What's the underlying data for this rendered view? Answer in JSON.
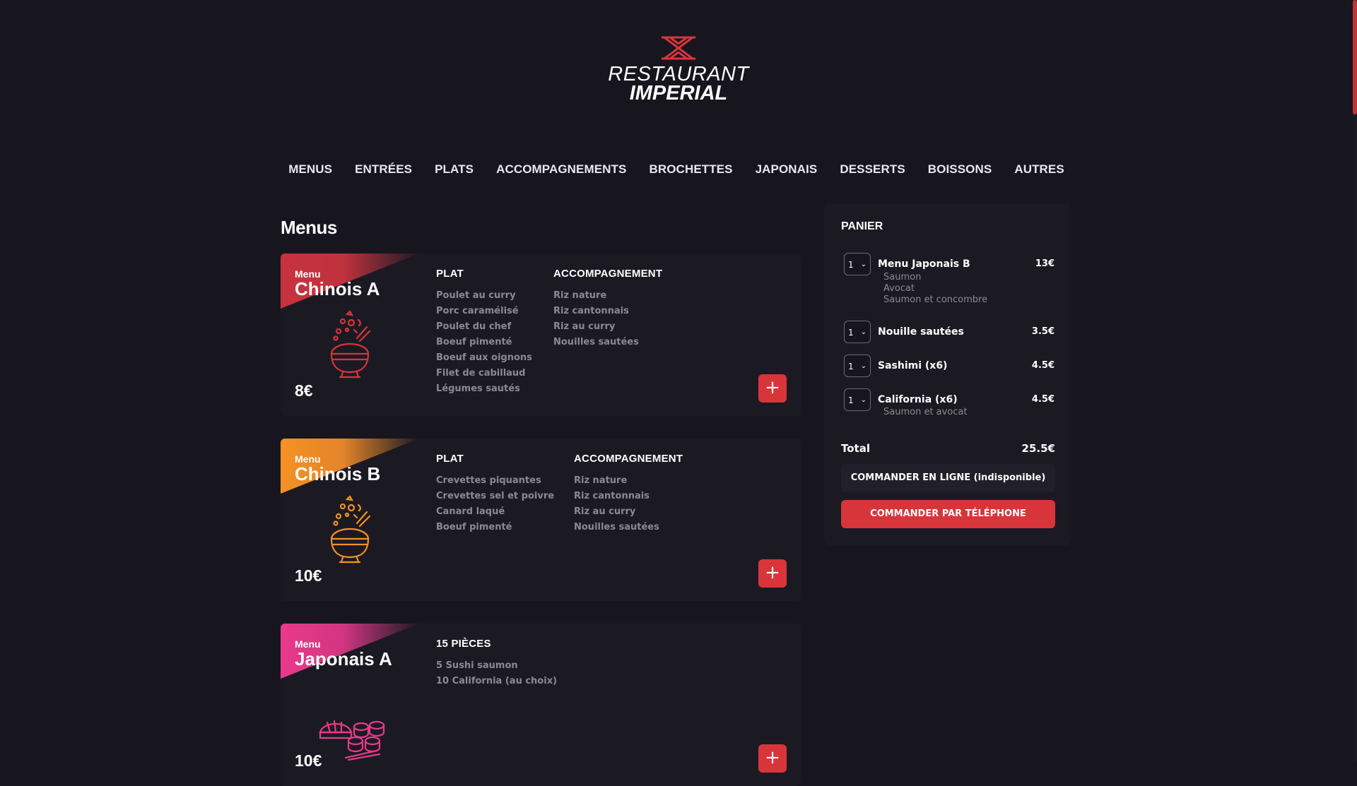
{
  "brand": {
    "line1": "RESTAURANT",
    "line2": "IMPERIAL",
    "accent": "#d8353b"
  },
  "nav": [
    "MENUS",
    "ENTRÉES",
    "PLATS",
    "ACCOMPAGNEMENTS",
    "BROCHETTES",
    "JAPONAIS",
    "DESSERTS",
    "BOISSONS",
    "AUTRES"
  ],
  "section_title": "Menus",
  "menus": [
    {
      "tag": "Menu",
      "name": "Chinois A",
      "price": "8€",
      "color": "#c8323e",
      "icon": "rice-bowl-icon",
      "col1": {
        "title": "PLAT",
        "items": [
          "Poulet au curry",
          "Porc caramélisé",
          "Poulet du chef",
          "Boeuf pimenté",
          "Boeuf aux oignons",
          "Filet de cabillaud",
          "Légumes sautés"
        ]
      },
      "col2": {
        "title": "ACCOMPAGNEMENT",
        "items": [
          "Riz nature",
          "Riz cantonnais",
          "Riz au curry",
          "Nouilles sautées"
        ]
      },
      "add_label": "+"
    },
    {
      "tag": "Menu",
      "name": "Chinois B",
      "price": "10€",
      "color": "#f59124",
      "icon": "rice-bowl-icon",
      "col1": {
        "title": "PLAT",
        "items": [
          "Crevettes piquantes",
          "Crevettes sel et poivre",
          "Canard laqué",
          "Boeuf pimenté"
        ]
      },
      "col2": {
        "title": "ACCOMPAGNEMENT",
        "items": [
          "Riz nature",
          "Riz cantonnais",
          "Riz au curry",
          "Nouilles sautées"
        ]
      },
      "add_label": "+"
    },
    {
      "tag": "Menu",
      "name": "Japonais A",
      "price": "10€",
      "color": "#e9398b",
      "icon": "sushi-icon",
      "col1": {
        "title": "15 PIÈCES",
        "items": [
          "5 Sushi saumon",
          "10 California (au choix)"
        ]
      },
      "add_label": "+"
    }
  ],
  "cart": {
    "title": "PANIER",
    "items": [
      {
        "qty": "1",
        "name": "Menu Japonais B",
        "price": "13€",
        "options": [
          "Saumon",
          "Avocat",
          "Saumon et concombre"
        ]
      },
      {
        "qty": "1",
        "name": "Nouille sautées",
        "price": "3.5€",
        "options": []
      },
      {
        "qty": "1",
        "name": "Sashimi (x6)",
        "price": "4.5€",
        "options": []
      },
      {
        "qty": "1",
        "name": "California (x6)",
        "price": "4.5€",
        "options": [
          "Saumon et avocat"
        ]
      }
    ],
    "total_label": "Total",
    "total_value": "25.5€",
    "order_online": "COMMANDER EN LIGNE (indisponible)",
    "order_phone": "COMMANDER PAR TÉLÉPHONE"
  }
}
